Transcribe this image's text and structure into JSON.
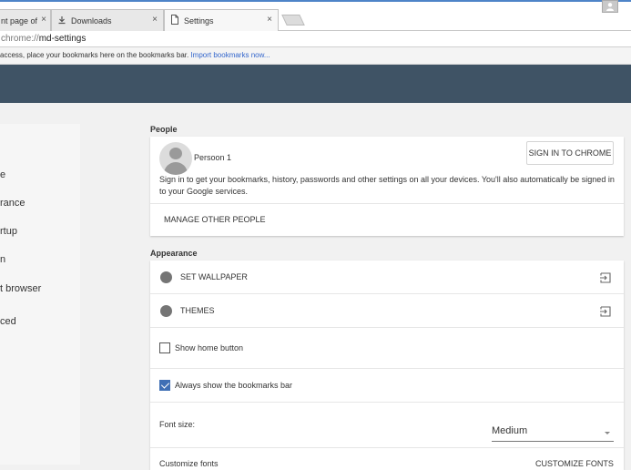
{
  "browser": {
    "tabs": [
      {
        "label": "nt page of",
        "active": false
      },
      {
        "label": "Downloads",
        "active": false
      },
      {
        "label": "Settings",
        "active": true
      }
    ],
    "close_glyph": "×",
    "omnibox_scheme": "chrome://",
    "omnibox_path": "md-settings",
    "bookmark_hint": "access, place your bookmarks here on the bookmarks bar.",
    "bookmark_import": "Import bookmarks now..."
  },
  "sidebar": {
    "items": [
      {
        "label": "e"
      },
      {
        "label": "rance"
      },
      {
        "label": "rtup"
      },
      {
        "label": "n"
      },
      {
        "label": "t browser"
      },
      {
        "label": "ced"
      }
    ]
  },
  "people": {
    "section_title": "People",
    "person_name": "Persoon 1",
    "signin_button": "SIGN IN TO CHROME",
    "signin_desc": "Sign in to get your bookmarks, history, passwords and other settings on all your devices. You'll also automatically be signed in to your Google services.",
    "manage_label": "MANAGE OTHER PEOPLE"
  },
  "appearance": {
    "section_title": "Appearance",
    "wallpaper_label": "SET WALLPAPER",
    "themes_label": "THEMES",
    "show_home_label": "Show home button",
    "show_home_checked": false,
    "bookmarks_bar_label": "Always show the bookmarks bar",
    "bookmarks_bar_checked": true,
    "font_size_label": "Font size:",
    "font_size_value": "Medium",
    "customize_fonts_label": "Customize fonts",
    "customize_fonts_button": "CUSTOMIZE FONTS"
  },
  "colors": {
    "header": "#3f5365",
    "checkbox_checked": "#3f6fb5",
    "link": "#3366cc"
  }
}
